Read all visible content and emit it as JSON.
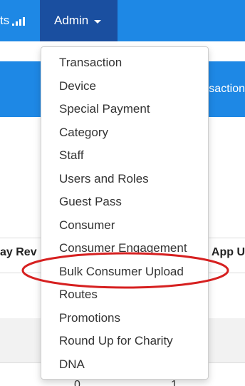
{
  "navbar": {
    "left_partial_label": "ts",
    "admin_label": "Admin",
    "signal_icon": "signal-bars-icon",
    "caret_icon": "caret-down-icon"
  },
  "banner": {
    "partial_label": "saction"
  },
  "table": {
    "header_left_partial": "ay Rev",
    "header_right_partial": "e App U",
    "cell_a": "0",
    "cell_b": "1"
  },
  "admin_menu": {
    "items": [
      {
        "label": "Transaction"
      },
      {
        "label": "Device"
      },
      {
        "label": "Special Payment"
      },
      {
        "label": "Category"
      },
      {
        "label": "Staff"
      },
      {
        "label": "Users and Roles"
      },
      {
        "label": "Guest Pass"
      },
      {
        "label": "Consumer"
      },
      {
        "label": "Consumer Engagement"
      },
      {
        "label": "Bulk Consumer Upload"
      },
      {
        "label": "Routes"
      },
      {
        "label": "Promotions"
      },
      {
        "label": "Round Up for Charity"
      },
      {
        "label": "DNA"
      }
    ],
    "highlighted_item": "Bulk Consumer Upload"
  },
  "colors": {
    "navbar": "#1e88e5",
    "admin_active": "#1a4fa0",
    "highlight": "#d62020"
  }
}
